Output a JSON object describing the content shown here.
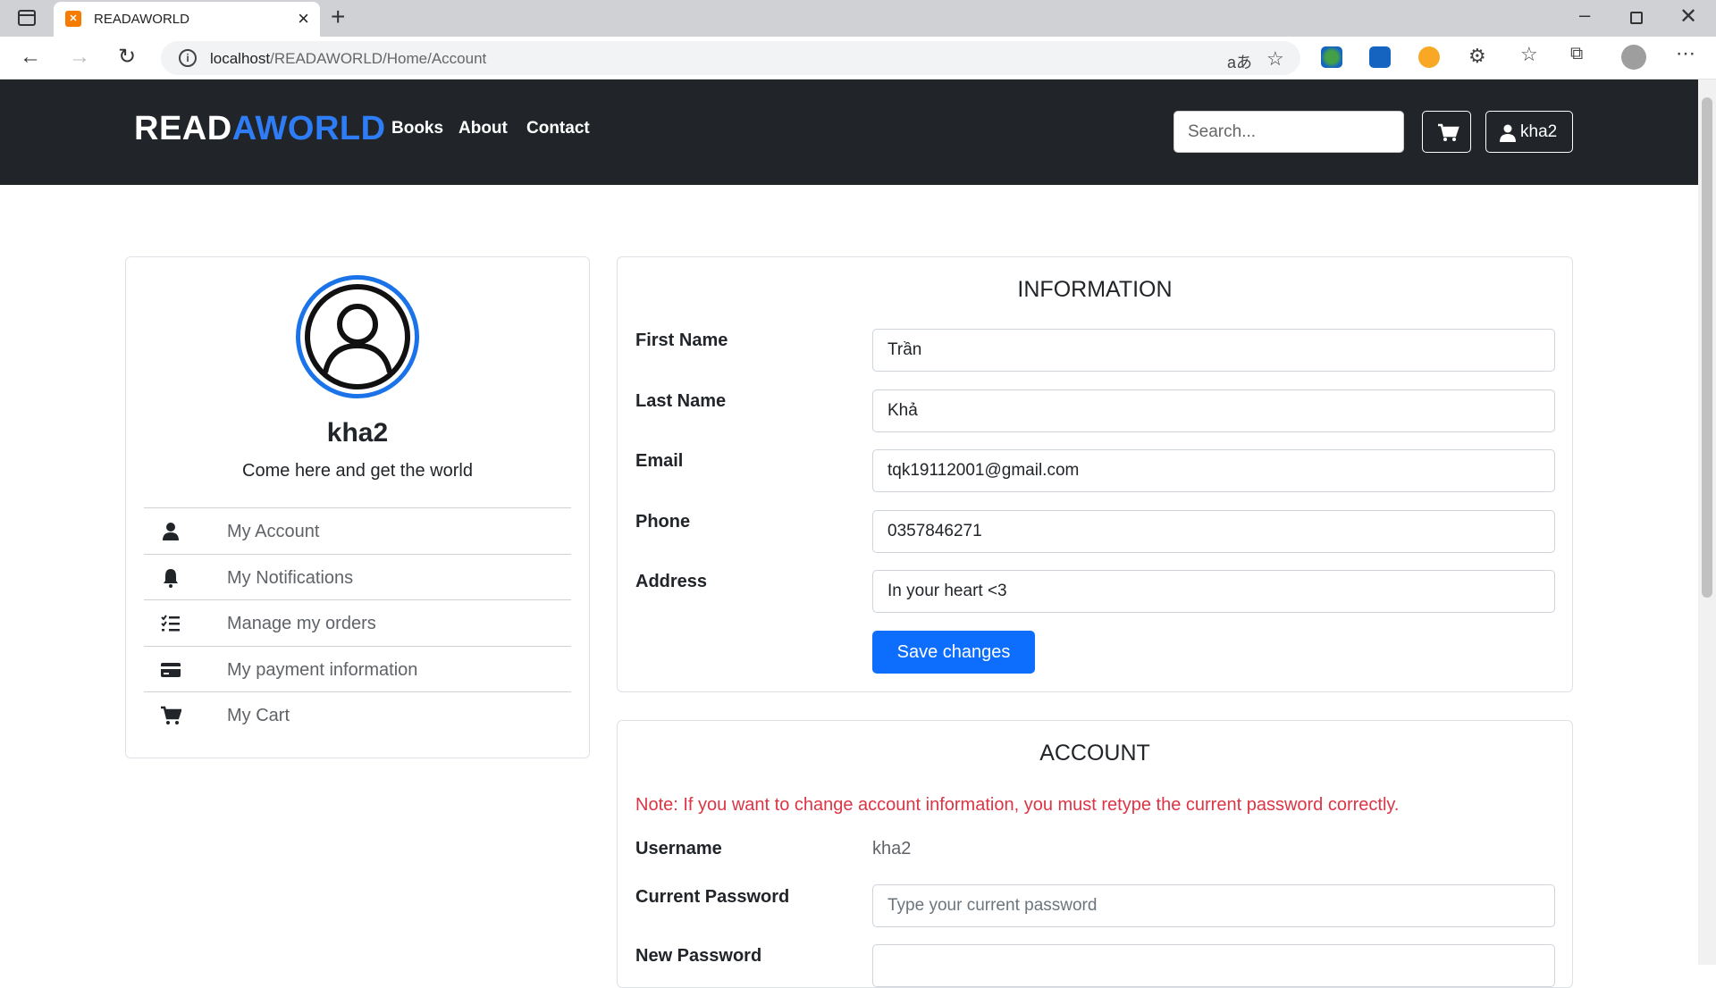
{
  "browser": {
    "tab_title": "READAWORLD",
    "url_host": "localhost",
    "url_path": "/READAWORLD/Home/Account"
  },
  "site": {
    "brand_part1": "READ",
    "brand_part2": "AWORLD",
    "nav": [
      "Books",
      "About",
      "Contact"
    ],
    "search_placeholder": "Search...",
    "user_button": "kha2",
    "accent_color": "#2e7df6"
  },
  "profile": {
    "name": "kha2",
    "tagline": "Come here and get the world",
    "menu": [
      {
        "label": "My Account",
        "icon": "user-icon"
      },
      {
        "label": "My Notifications",
        "icon": "bell-icon"
      },
      {
        "label": "Manage my orders",
        "icon": "list-check-icon"
      },
      {
        "label": "My payment information",
        "icon": "credit-card-icon"
      },
      {
        "label": "My Cart",
        "icon": "cart-icon"
      }
    ]
  },
  "information": {
    "title": "INFORMATION",
    "fields": [
      {
        "label": "First Name",
        "value": "Trần"
      },
      {
        "label": "Last Name",
        "value": "Khả"
      },
      {
        "label": "Email",
        "value": "tqk19112001@gmail.com"
      },
      {
        "label": "Phone",
        "value": "0357846271"
      },
      {
        "label": "Address",
        "value": "In your heart <3"
      }
    ],
    "save_label": "Save changes"
  },
  "account": {
    "title": "ACCOUNT",
    "note": "Note: If you want to change account information, you must retype the current password correctly.",
    "username_label": "Username",
    "username_value": "kha2",
    "current_password_label": "Current Password",
    "current_password_placeholder": "Type your current password",
    "new_password_label": "New Password"
  }
}
